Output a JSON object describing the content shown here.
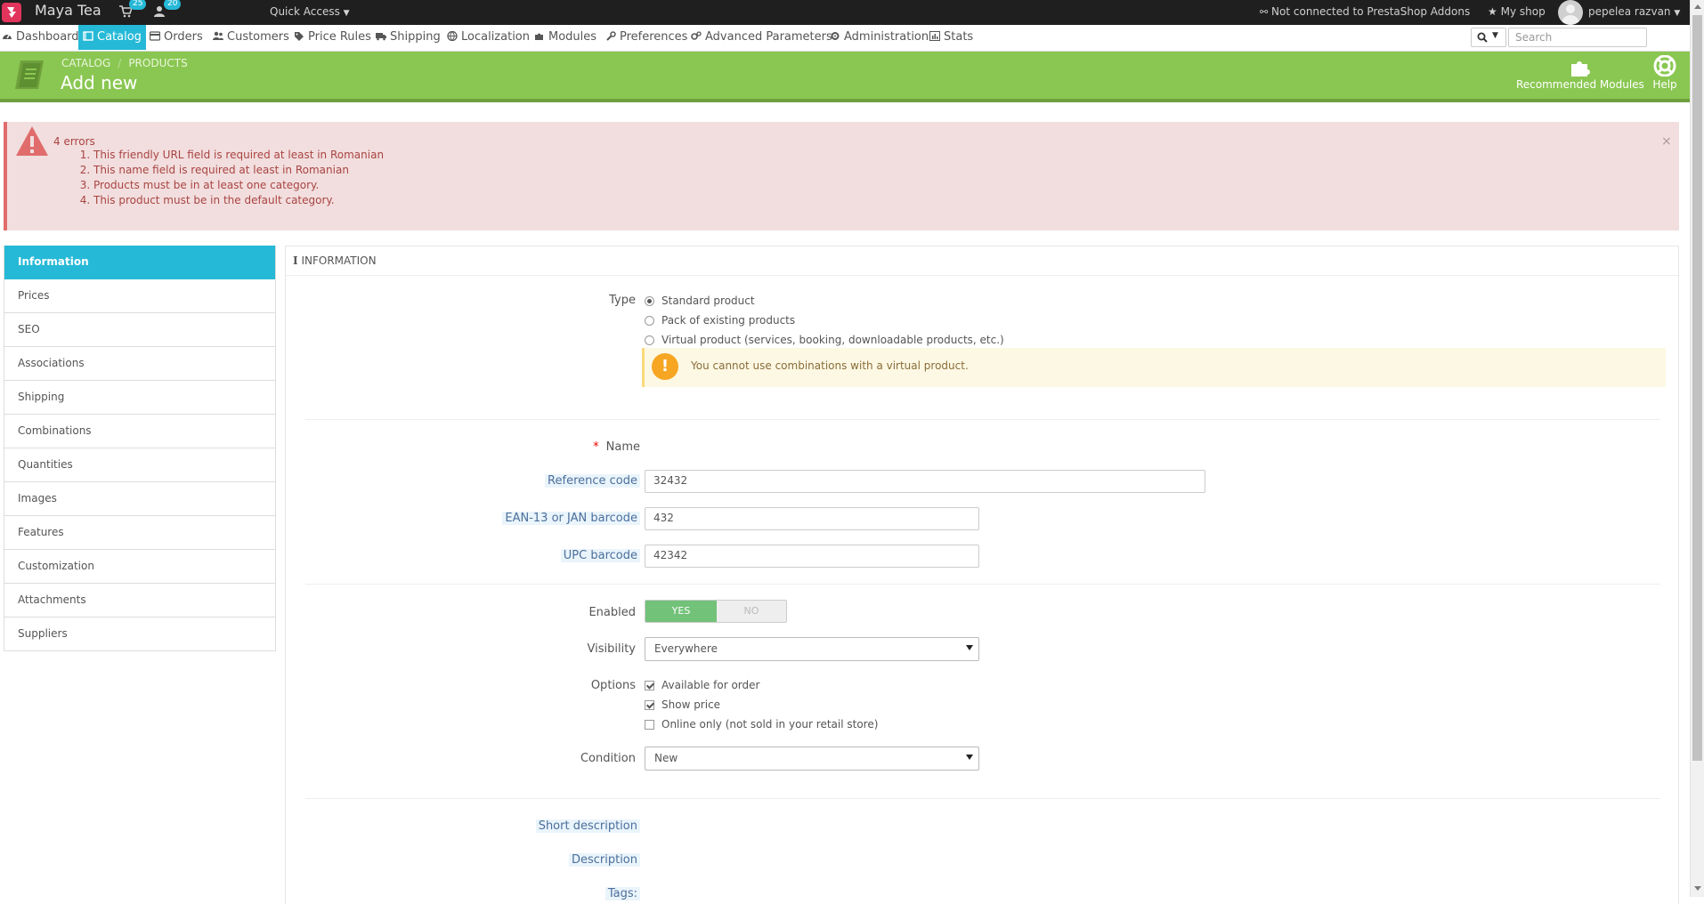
{
  "topbar": {
    "shop_name": "Maya Tea",
    "orders_count": "25",
    "customers_count": "20",
    "quick_access": "Quick Access",
    "addons_status": "Not connected to PrestaShop Addons",
    "my_shop": "My shop",
    "user_name": "pepelea razvan"
  },
  "nav": {
    "items": [
      "Dashboard",
      "Catalog",
      "Orders",
      "Customers",
      "Price Rules",
      "Shipping",
      "Localization",
      "Modules",
      "Preferences",
      "Advanced Parameters",
      "Administration",
      "Stats"
    ],
    "active": "Catalog",
    "search_placeholder": "Search"
  },
  "header": {
    "breadcrumb": [
      "Catalog",
      "Products"
    ],
    "title": "Add new",
    "recommended_modules": "Recommended Modules",
    "help": "Help",
    "accent_color": "#8ac752"
  },
  "alert": {
    "count_text": "4 errors",
    "errors": [
      "This friendly URL field is required at least in Romanian",
      "This name field is required at least in Romanian",
      "Products must be in at least one category.",
      "This product must be in the default category."
    ]
  },
  "tabs": {
    "items": [
      "Information",
      "Prices",
      "SEO",
      "Associations",
      "Shipping",
      "Combinations",
      "Quantities",
      "Images",
      "Features",
      "Customization",
      "Attachments",
      "Suppliers"
    ],
    "active": "Information"
  },
  "form": {
    "panel_title": "Information",
    "type_label": "Type",
    "type_options": [
      "Standard product",
      "Pack of existing products",
      "Virtual product (services, booking, downloadable products, etc.)"
    ],
    "type_selected": "Standard product",
    "virtual_warning": "You cannot use combinations with a virtual product.",
    "name_label": "Name",
    "reference_label": "Reference code",
    "reference_value": "32432",
    "ean_label": "EAN-13 or JAN barcode",
    "ean_value": "432",
    "upc_label": "UPC barcode",
    "upc_value": "42342",
    "enabled_label": "Enabled",
    "enabled_yes": "Yes",
    "enabled_no": "No",
    "visibility_label": "Visibility",
    "visibility_value": "Everywhere",
    "options_label": "Options",
    "options": [
      {
        "label": "Available for order",
        "checked": true
      },
      {
        "label": "Show price",
        "checked": true
      },
      {
        "label": "Online only (not sold in your retail store)",
        "checked": false
      }
    ],
    "condition_label": "Condition",
    "condition_value": "New",
    "short_description_label": "Short description",
    "description_label": "Description",
    "tags_label": "Tags:"
  }
}
